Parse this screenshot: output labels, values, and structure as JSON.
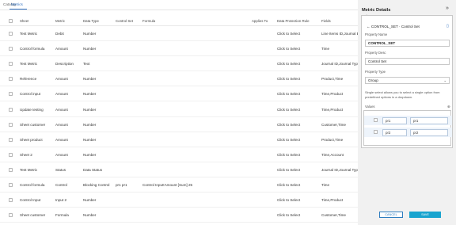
{
  "tabs": [
    "Catalog",
    "Metrics"
  ],
  "columns": [
    "Sheet",
    "Metric",
    "Data Type",
    "Control Set",
    "Formula",
    "Applies To",
    "Data Protection Rule",
    "Fields"
  ],
  "rows": [
    [
      "Test Metric",
      "Debit",
      "Number",
      "",
      "",
      "",
      "Click to Select",
      "Line Items ID,Journal E"
    ],
    [
      "Control formula",
      "Amount",
      "Number",
      "",
      "",
      "",
      "Click to Select",
      "Time"
    ],
    [
      "Test Metric",
      "Description",
      "Text",
      "",
      "",
      "",
      "Click to Select",
      "Journal ID,Journal Type"
    ],
    [
      "Reference",
      "Amount",
      "Number",
      "",
      "",
      "",
      "Click to Select",
      "Product,Time"
    ],
    [
      "Control input",
      "Amount",
      "Number",
      "",
      "",
      "",
      "Click to Select",
      "Time,Product"
    ],
    [
      "Update testing",
      "Amount",
      "Number",
      "",
      "",
      "",
      "Click to Select",
      "Time,Product"
    ],
    [
      "Sheet customer",
      "Amount",
      "Number",
      "",
      "",
      "",
      "Click to Select",
      "Customer,Time"
    ],
    [
      "Sheet product",
      "Amount",
      "Number",
      "",
      "",
      "",
      "Click to Select",
      "Product,Time"
    ],
    [
      "Sheet 2",
      "Amount",
      "Number",
      "",
      "",
      "",
      "Click to Select",
      "Time,Account"
    ],
    [
      "Test Metric",
      "Status",
      "Data Status",
      "",
      "",
      "",
      "Click to Select",
      "Journal ID,Journal Type"
    ],
    [
      "Control formula",
      "Control",
      "Blocking Control",
      "pr1   pr1",
      "Control Input!Amount [Sum] 25",
      "",
      "Click to Select",
      "Time"
    ],
    [
      "Control Input",
      "Input 2",
      "Number",
      "",
      "",
      "",
      "Click to Select",
      "Time,Product"
    ],
    [
      "Sheet customer",
      "Formula",
      "Number",
      "",
      "",
      "",
      "Click to Select",
      "Customer,Time"
    ]
  ],
  "panel": {
    "title": "Metric Details",
    "close_icon": "»",
    "section": "Columns",
    "breadcrumb": "CONTROL_SET · Control Set",
    "property_name_label": "Property Name",
    "property_name_value": "CONTROL_SET",
    "property_desc_label": "Property Desc",
    "property_desc_value": "Control Set",
    "property_type_label": "Property Type",
    "property_type_value": "Group",
    "help_text": "Single select allows you to select a single option from predefined options in a dropdown.",
    "values_label": "Values",
    "values": [
      [
        "pr1",
        "pr1"
      ],
      [
        "pr2",
        "pr2"
      ]
    ]
  },
  "buttons": {
    "cancel": "CANCEL",
    "save": "SAVE"
  },
  "colors": {
    "accent": "#2f6fbf",
    "save": "#1aa4cf",
    "panel_bg": "#f1f1f1"
  }
}
